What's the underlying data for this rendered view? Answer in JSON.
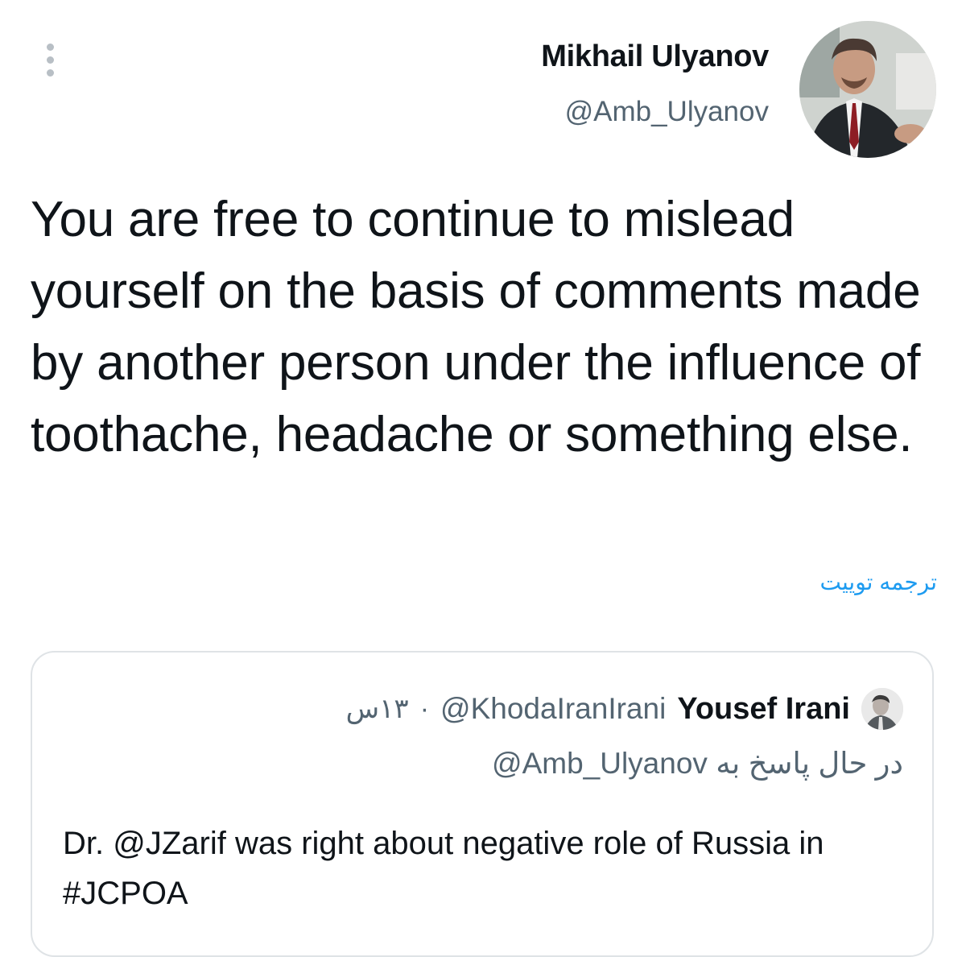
{
  "tweet": {
    "author_name": "Mikhail Ulyanov",
    "author_handle": "@Amb_Ulyanov",
    "text": "You are free to continue to mislead yourself on the basis of comments made by another person under the influence of toothache, headache or something else.",
    "translate_label": "ترجمه توییت"
  },
  "quoted": {
    "author_name": "Yousef Irani",
    "author_handle": "@KhodaIranIrani",
    "separator": "·",
    "time": "۱۳س",
    "reply_prefix": "در حال پاسخ به",
    "reply_target": "@Amb_Ulyanov",
    "text": "Dr. @JZarif was right about negative role of Russia in #JCPOA"
  },
  "icons": {
    "more": "more-vertical-icon",
    "avatar_main": "avatar-icon",
    "avatar_quoted": "avatar-icon"
  },
  "colors": {
    "text_primary": "#0f1419",
    "text_secondary": "#536471",
    "link": "#1d9bf0",
    "border": "#dfe3e6"
  }
}
